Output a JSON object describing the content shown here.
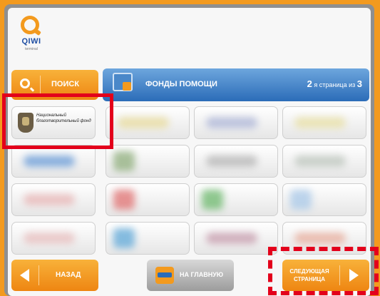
{
  "logo": {
    "text": "QIWI",
    "sub": "terminal"
  },
  "search": {
    "label": "ПОИСК"
  },
  "header": {
    "title": "ФОНДЫ ПОМОЩИ",
    "page_num": "2",
    "page_suffix": "я страница из",
    "page_total": "3"
  },
  "fund": {
    "label": "Национальный благотворительный фонд"
  },
  "nav": {
    "back": "НАЗАД",
    "home": "НА ГЛАВНУЮ",
    "next_line1": "СЛЕДУЮЩАЯ",
    "next_line2": "СТРАНИЦА"
  },
  "colors": {
    "accent_orange": "#f39a1e",
    "header_blue": "#2b6cb8",
    "highlight_red": "#e3001b"
  }
}
